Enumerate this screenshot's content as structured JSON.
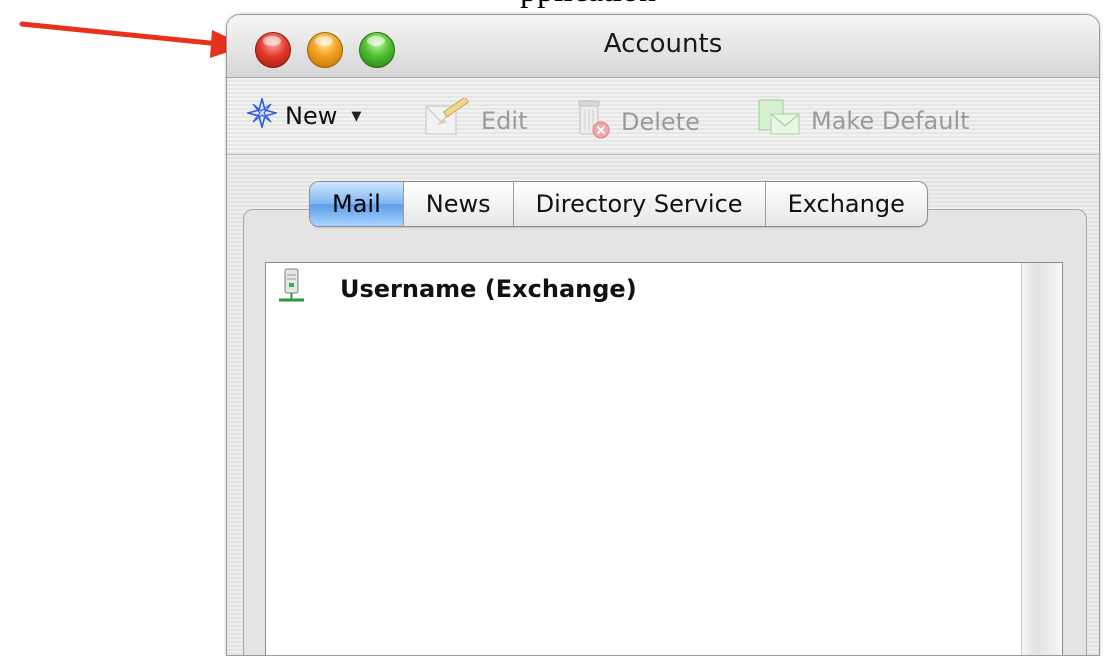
{
  "background": {
    "cutoff_text": "pplication"
  },
  "window": {
    "title": "Accounts",
    "traffic_lights": {
      "close": "#e23b2c",
      "minimize": "#f0a020",
      "zoom": "#4cbf30"
    }
  },
  "annotation": {
    "arrow_color": "#e8301c"
  },
  "toolbar": {
    "new_label": "New",
    "edit_label": "Edit",
    "delete_label": "Delete",
    "make_default_label": "Make Default",
    "icons": [
      "new-star-icon",
      "edit-pencil-icon",
      "delete-trash-icon",
      "make-default-icon"
    ]
  },
  "tabs": [
    {
      "label": "Mail",
      "active": true
    },
    {
      "label": "News",
      "active": false
    },
    {
      "label": "Directory Service",
      "active": false
    },
    {
      "label": "Exchange",
      "active": false
    }
  ],
  "accounts": [
    {
      "name": "Username (Exchange)",
      "icon": "server-icon"
    }
  ]
}
